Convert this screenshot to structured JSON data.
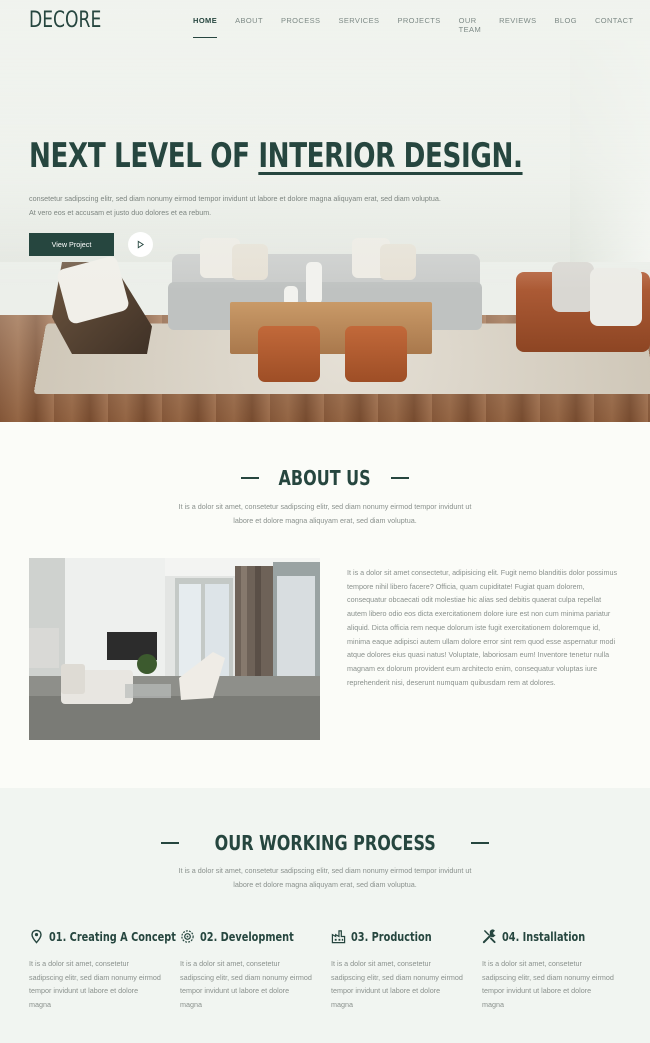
{
  "brand": {
    "logo": "DECORE",
    "accent": "#26463f"
  },
  "nav": {
    "items": [
      {
        "label": "HOME",
        "active": true
      },
      {
        "label": "ABOUT"
      },
      {
        "label": "PROCESS"
      },
      {
        "label": "SERVICES"
      },
      {
        "label": "PROJECTS"
      },
      {
        "label": "OUR TEAM"
      },
      {
        "label": "REVIEWS"
      },
      {
        "label": "BLOG"
      },
      {
        "label": "CONTACT"
      }
    ]
  },
  "hero": {
    "title_plain": "NEXT LEVEL OF ",
    "title_underline": "INTERIOR DESIGN.",
    "description": "consetetur sadipscing elitr, sed diam nonumy eirmod tempor invidunt ut labore et dolore magna aliquyam erat, sed diam voluptua. At vero eos et accusam et justo duo dolores et ea rebum.",
    "cta_label": "View Project",
    "play_icon": "play-icon"
  },
  "about": {
    "title": "ABOUT US",
    "subtitle": "It is a dolor sit amet, consetetur sadipscing elitr, sed diam nonumy eirmod tempor invidunt ut labore et dolore magna aliquyam erat, sed diam voluptua.",
    "body": "It is a dolor sit amet consectetur, adipisicing elit. Fugit nemo blanditiis dolor possimus tempore nihil libero facere? Officia, quam cupiditate! Fugiat quam dolorem, consequatur obcaecati odit molestiae hic alias sed debitis quaerat culpa repellat autem libero odio eos dicta exercitationem dolore iure est non cum minima pariatur aliquid. Dicta officia rem neque dolorum iste fugit exercitationem doloremque id, minima eaque adipisci autem ullam dolore error sint rem quod esse aspernatur modi atque dolores eius quasi natus! Voluptate, laboriosam eum! Inventore tenetur nulla magnam ex dolorum provident eum architecto enim, consequatur voluptas iure reprehenderit nisi, deserunt numquam quibusdam rem at dolores."
  },
  "process": {
    "title": "OUR WORKING PROCESS",
    "subtitle": "It is a dolor sit amet, consetetur sadipscing elitr, sed diam nonumy eirmod tempor invidunt ut labore et dolore magna aliquyam erat, sed diam voluptua.",
    "steps": [
      {
        "title": "01. Creating A Concept",
        "icon": "location-pin-icon",
        "text": "It is a dolor sit amet, consetetur sadipscing elitr, sed diam nonumy eirmod tempor invidunt ut labore et dolore magna"
      },
      {
        "title": "02. Development",
        "icon": "target-icon",
        "text": "It is a dolor sit amet, consetetur sadipscing elitr, sed diam nonumy eirmod tempor invidunt ut labore et dolore magna"
      },
      {
        "title": "03. Production",
        "icon": "factory-icon",
        "text": "It is a dolor sit amet, consetetur sadipscing elitr, sed diam nonumy eirmod tempor invidunt ut labore et dolore magna"
      },
      {
        "title": "04. Installation",
        "icon": "tools-icon",
        "text": "It is a dolor sit amet, consetetur sadipscing elitr, sed diam nonumy eirmod tempor invidunt ut labore et dolore magna"
      }
    ]
  }
}
